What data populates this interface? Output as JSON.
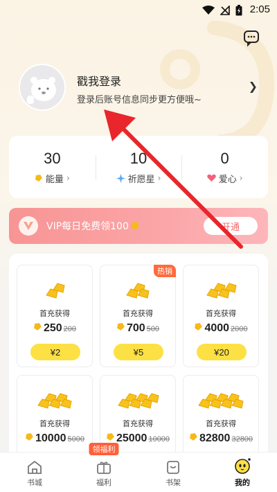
{
  "status_bar": {
    "time": "2:05"
  },
  "profile": {
    "title": "戳我登录",
    "subtitle": "登录后账号信息同步更方便哦~"
  },
  "stats": [
    {
      "value": "30",
      "label": "能量",
      "icon": "energy-coin-icon",
      "arrow": "›"
    },
    {
      "value": "10",
      "label": "祈愿星",
      "icon": "wish-star-icon",
      "arrow": "›"
    },
    {
      "value": "0",
      "label": "爱心",
      "icon": "heart-icon",
      "arrow": "›"
    }
  ],
  "vip": {
    "text": "VIP每日免费领100",
    "button": "开通"
  },
  "packages": [
    {
      "first": "首充获得",
      "amount": "250",
      "original": "200",
      "price": "¥2",
      "hot": ""
    },
    {
      "first": "首充获得",
      "amount": "700",
      "original": "500",
      "price": "¥5",
      "hot": "热销"
    },
    {
      "first": "首充获得",
      "amount": "4000",
      "original": "2000",
      "price": "¥20",
      "hot": ""
    },
    {
      "first": "首充获得",
      "amount": "10000",
      "original": "5000",
      "price": "",
      "hot": ""
    },
    {
      "first": "首充获得",
      "amount": "25000",
      "original": "10000",
      "price": "",
      "hot": ""
    },
    {
      "first": "首充获得",
      "amount": "82800",
      "original": "32800",
      "price": "",
      "hot": ""
    }
  ],
  "nav": {
    "items": [
      {
        "label": "书城",
        "icon": "home-icon"
      },
      {
        "label": "福利",
        "icon": "gift-icon",
        "badge": "领福利"
      },
      {
        "label": "书架",
        "icon": "bookshelf-icon"
      },
      {
        "label": "我的",
        "icon": "profile-mascot-icon"
      }
    ]
  },
  "colors": {
    "accent_yellow": "#fde043",
    "vip_pink": "#f89494",
    "hot_orange": "#ff6b3d",
    "arrow_red": "#e8262b"
  }
}
